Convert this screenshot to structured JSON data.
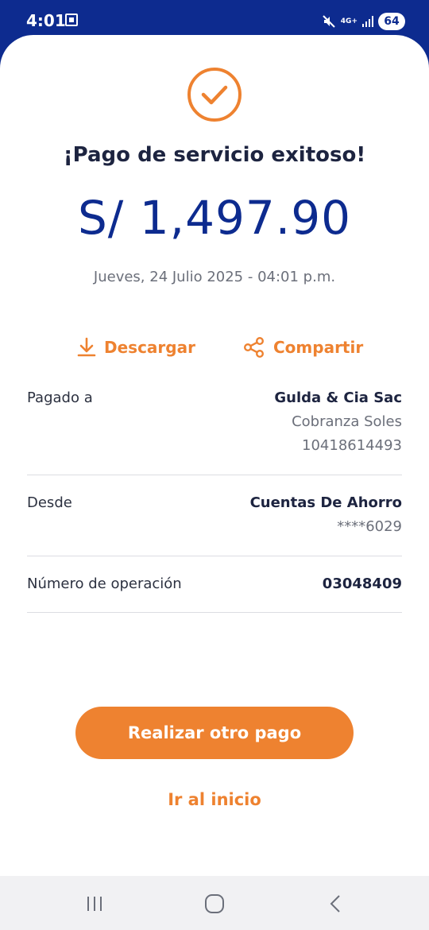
{
  "status_bar": {
    "time": "4:01",
    "network": "4G+",
    "battery": "64"
  },
  "receipt": {
    "title": "¡Pago de servicio exitoso!",
    "amount": "S/ 1,497.90",
    "date": "Jueves, 24 Julio 2025 - 04:01 p.m.",
    "accent_color": "#ee8230",
    "brand_color": "#0d2b8f"
  },
  "actions": {
    "download_label": "Descargar",
    "share_label": "Compartir"
  },
  "details": {
    "paid_to": {
      "label": "Pagado a",
      "name": "Gulda & Cia Sac",
      "service": "Cobranza Soles",
      "code": "10418614493"
    },
    "from": {
      "label": "Desde",
      "account": "Cuentas De Ahorro",
      "masked_number": "****6029"
    },
    "operation": {
      "label": "Número de operación",
      "number": "03048409"
    }
  },
  "buttons": {
    "primary": "Realizar otro pago",
    "secondary": "Ir al inicio"
  }
}
